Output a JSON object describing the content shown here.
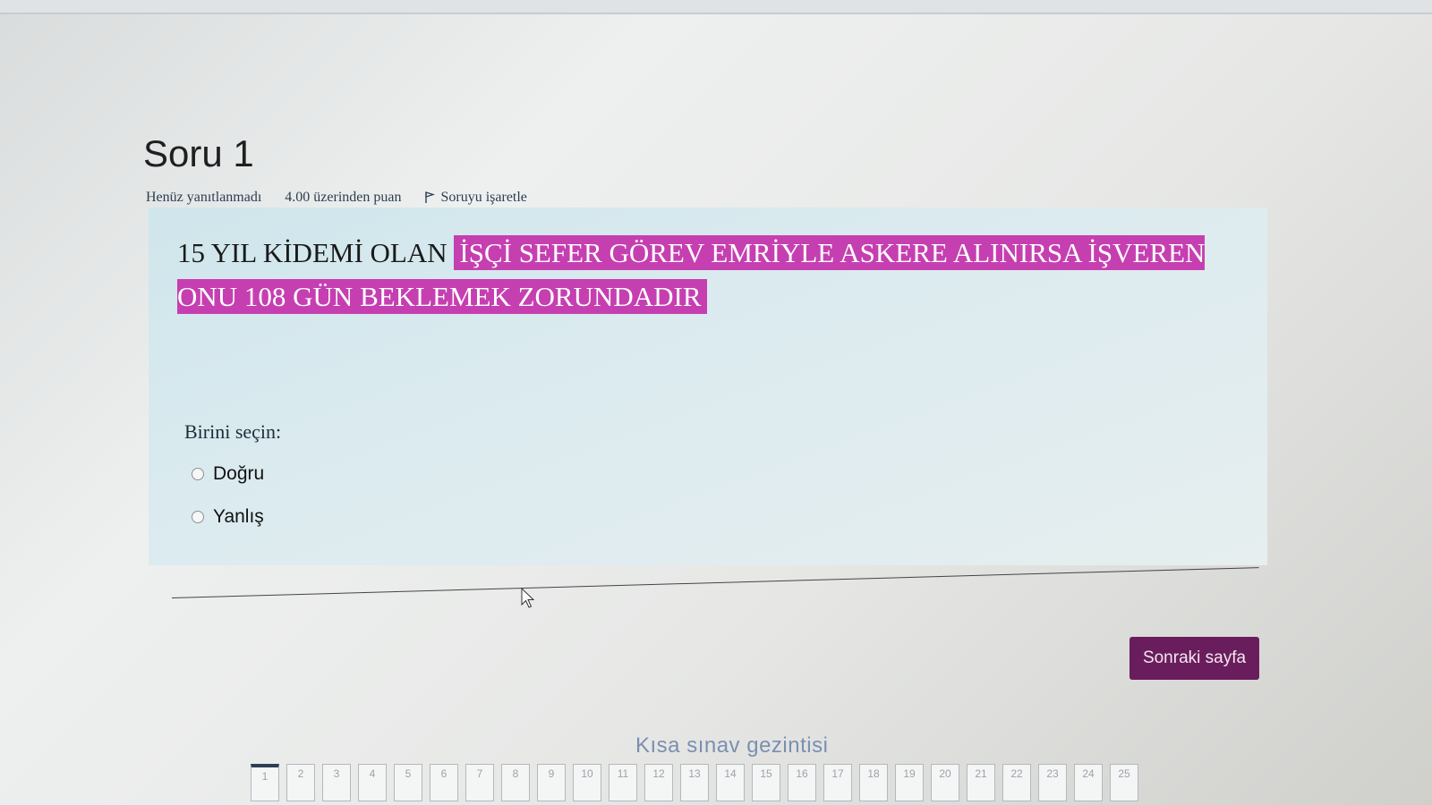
{
  "question": {
    "title": "Soru 1",
    "status": "Henüz yanıtlanmadı",
    "points": "4.00 üzerinden puan",
    "flag_label": "Soruyu işaretle",
    "text_plain": "15 YIL KİDEMİ OLAN ",
    "text_highlighted": "İŞÇİ SEFER GÖREV EMRİYLE ASKERE ALINIRSA İŞVEREN ONU 108 GÜN BEKLEMEK ZORUNDADIR",
    "prompt": "Birini seçin:",
    "options": [
      {
        "label": "Doğru",
        "selected": false
      },
      {
        "label": "Yanlış",
        "selected": false
      }
    ]
  },
  "actions": {
    "next_label": "Sonraki sayfa"
  },
  "navigation": {
    "title": "Kısa sınav gezintisi",
    "items": [
      "1",
      "2",
      "3",
      "4",
      "5",
      "6",
      "7",
      "8",
      "9",
      "10",
      "11",
      "12",
      "13",
      "14",
      "15",
      "16",
      "17",
      "18",
      "19",
      "20",
      "21",
      "22",
      "23",
      "24",
      "25"
    ],
    "current": "1"
  },
  "colors": {
    "highlight": "#c63fb1",
    "next_button": "#6a1d5c",
    "question_box": "#d6e9ee"
  }
}
